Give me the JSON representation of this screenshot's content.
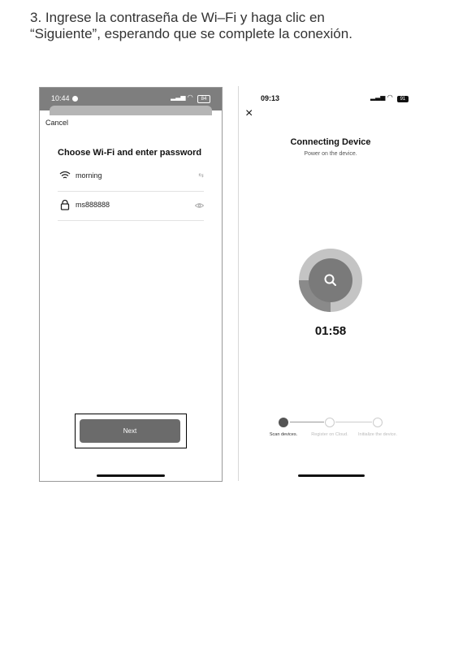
{
  "instruction": {
    "line1": "3. Ingrese la contraseña de Wi–Fi y haga clic en",
    "line2": "“Siguiente”, esperando que se complete la conexión."
  },
  "left_phone": {
    "status_time": "10:44",
    "status_battery": "84",
    "cancel_label": "Cancel",
    "title": "Choose Wi-Fi and enter password",
    "wifi_name": "morning",
    "password": "ms888888",
    "next_label": "Next"
  },
  "right_phone": {
    "status_time": "09:13",
    "status_battery": "91",
    "close_label": "×",
    "title": "Connecting Device",
    "subtitle": "Power on the device.",
    "timer": "01:58",
    "progress": 0.25,
    "steps": [
      {
        "label": "Scan devices.",
        "state": "active"
      },
      {
        "label": "Register on Cloud.",
        "state": "inactive"
      },
      {
        "label": "Initialize the device.",
        "state": "inactive"
      }
    ]
  },
  "colors": {
    "primary_button": "#6b6b6b",
    "ring_light": "#c4c4c4",
    "ring_dark": "#8a8a8a",
    "center": "#7a7a7a"
  }
}
